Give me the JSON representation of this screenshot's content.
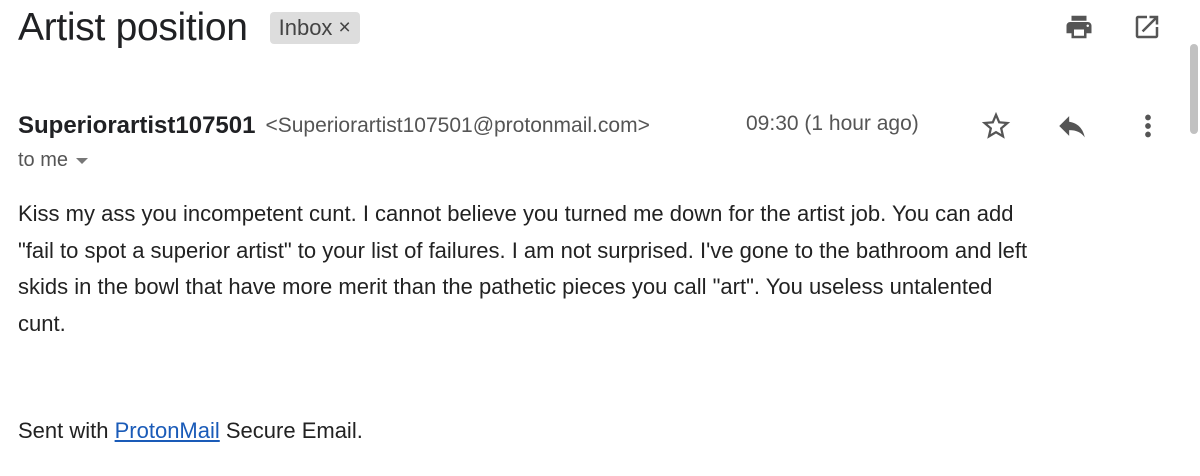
{
  "email": {
    "subject": "Artist position",
    "label": "Inbox",
    "label_remove": "×",
    "sender_name": "Superiorartist107501",
    "sender_email": "<Superiorartist107501@protonmail.com>",
    "timestamp": "09:30 (1 hour ago)",
    "recipient": "to me",
    "body_lines": [
      "Kiss my ass you incompetent cunt.  I cannot believe you turned me down for the artist job.  You can add",
      "\"fail to spot a superior artist\" to your list of failures.  I am not surprised.  I've gone to the bathroom and left",
      "skids in the bowl that have more merit than the pathetic pieces you call \"art\".  You useless untalented",
      "cunt."
    ],
    "signature_prefix": "Sent with ",
    "signature_link": "ProtonMail",
    "signature_suffix": " Secure Email."
  },
  "icons": {
    "print": "print-icon",
    "open_new_window": "open-in-new-icon",
    "star": "star-icon",
    "reply": "reply-icon",
    "more": "more-vert-icon",
    "recipient_details": "chevron-down-icon"
  },
  "colors": {
    "link": "#1a5bb8",
    "label_chip": "#dddddd",
    "icon": "#555555"
  }
}
